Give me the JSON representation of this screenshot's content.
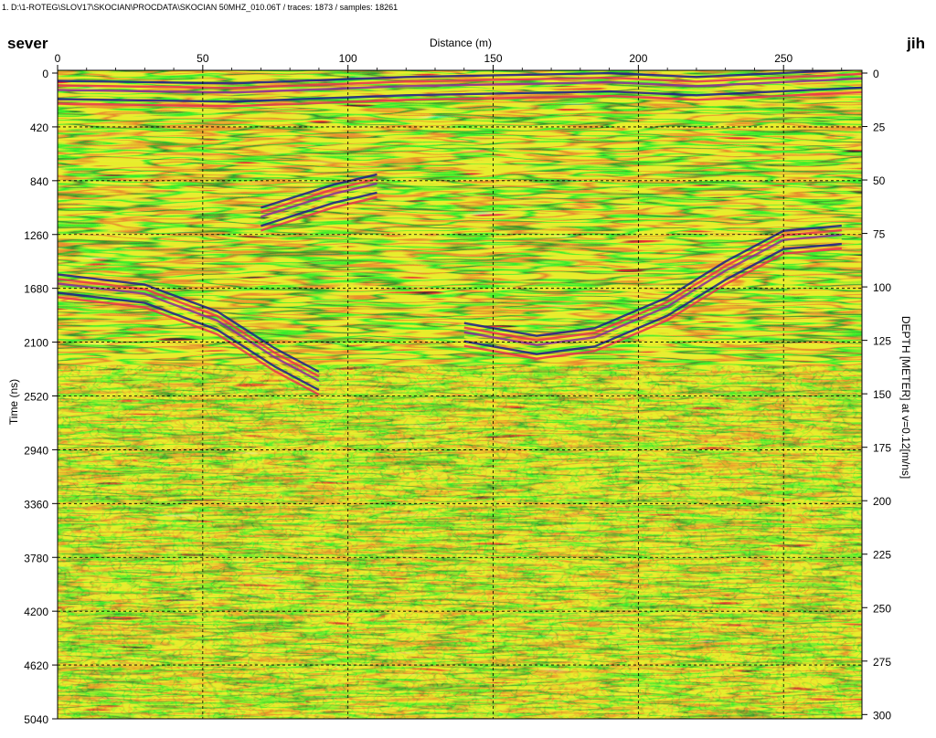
{
  "header": {
    "path_text": "1. D:\\1-ROTEG\\SLOV17\\SKOCIAN\\PROCDATA\\SKOCIAN 50MHZ_010.06T / traces: 1873 / samples: 18261",
    "left_label": "sever",
    "right_label": "jih"
  },
  "chart_data": {
    "type": "heatmap",
    "title": "",
    "xlabel": "Distance (m)",
    "ylabel": "Time (ns)",
    "y2label": "DEPTH [METER] at v=0.12[m/ns]",
    "xlim": [
      0,
      277
    ],
    "ylim": [
      0,
      5040
    ],
    "y2lim": [
      0,
      302
    ],
    "x_ticks": [
      0,
      50,
      100,
      150,
      200,
      250
    ],
    "y_ticks": [
      0,
      420,
      840,
      1260,
      1680,
      2100,
      2520,
      2940,
      3360,
      3780,
      4200,
      4620,
      5040
    ],
    "y2_ticks": [
      0,
      25,
      50,
      75,
      100,
      125,
      150,
      175,
      200,
      225,
      250,
      275,
      300
    ],
    "grid": true,
    "colors": {
      "background": "#e8ec2c",
      "strong_negative": "#1c1a8c",
      "negative": "#8a2a9a",
      "positive": "#e83050",
      "weak": "#2a8a32"
    },
    "reflectors": [
      {
        "name": "",
        "points": [
          [
            0,
            1660
          ],
          [
            30,
            1740
          ],
          [
            55,
            1950
          ],
          [
            75,
            2240
          ],
          [
            90,
            2420
          ]
        ]
      },
      {
        "name": "",
        "points": [
          [
            140,
            2040
          ],
          [
            165,
            2140
          ],
          [
            185,
            2080
          ],
          [
            210,
            1840
          ],
          [
            230,
            1560
          ],
          [
            250,
            1320
          ],
          [
            270,
            1280
          ]
        ]
      },
      {
        "name": "",
        "points": [
          [
            0,
            150
          ],
          [
            60,
            170
          ],
          [
            120,
            120
          ],
          [
            190,
            90
          ],
          [
            220,
            120
          ],
          [
            277,
            60
          ]
        ]
      },
      {
        "name": "",
        "points": [
          [
            70,
            1140
          ],
          [
            95,
            960
          ],
          [
            110,
            880
          ]
        ]
      }
    ]
  }
}
